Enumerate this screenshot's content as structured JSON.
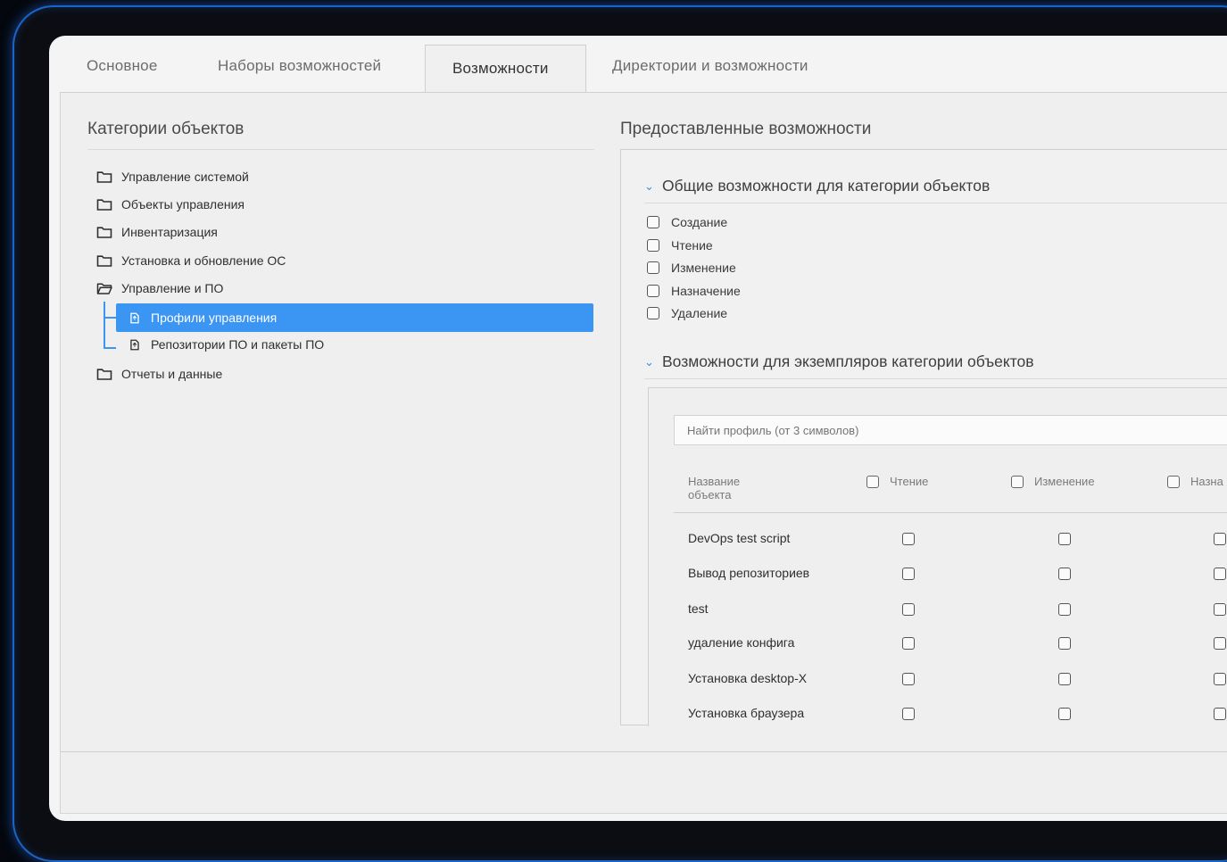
{
  "tabs": [
    {
      "label": "Основное",
      "active": false
    },
    {
      "label": "Наборы возможностей",
      "active": false
    },
    {
      "label": "Возможности",
      "active": true
    },
    {
      "label": "Директории и возможности",
      "active": false
    }
  ],
  "left": {
    "title": "Категории объектов",
    "tree": [
      {
        "label": "Управление системой",
        "icon": "folder-icon"
      },
      {
        "label": "Объекты управления",
        "icon": "folder-icon"
      },
      {
        "label": "Инвентаризация",
        "icon": "folder-icon"
      },
      {
        "label": "Установка и обновление ОС",
        "icon": "folder-icon"
      },
      {
        "label": "Управление и ПО",
        "icon": "folder-open-icon"
      },
      {
        "label": "Профили управления",
        "icon": "file-icon",
        "selected": true
      },
      {
        "label": "Репозитории ПО и пакеты ПО",
        "icon": "file-icon"
      },
      {
        "label": "Отчеты и данные",
        "icon": "folder-icon"
      }
    ]
  },
  "right": {
    "title": "Предоставленные возможности",
    "general": {
      "title": "Общие возможности для категории объектов",
      "options": [
        "Создание",
        "Чтение",
        "Изменение",
        "Назначение",
        "Удаление"
      ]
    },
    "instances": {
      "title": "Возможности для экземпляров категории объектов",
      "search_placeholder": "Найти профиль (от 3 символов)",
      "columns": {
        "name": "Название объекта",
        "read": "Чтение",
        "edit": "Изменение",
        "assign": "Назна"
      },
      "rows": [
        "DevOps test script",
        "Вывод репозиториев",
        "test",
        "удаление конфига",
        "Установка desktop-X",
        "Установка браузера"
      ]
    }
  },
  "colors": {
    "accent": "#3b95f3",
    "glow": "#1b64c8"
  }
}
